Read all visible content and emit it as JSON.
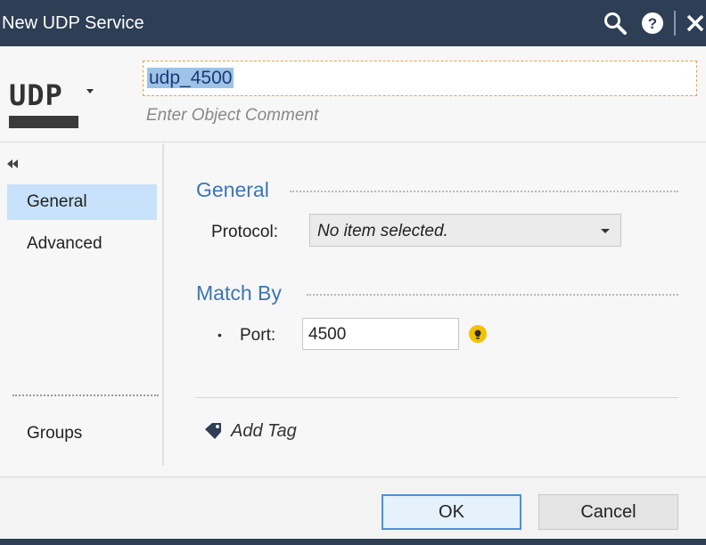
{
  "window": {
    "title": "New UDP Service"
  },
  "header": {
    "type_label": "UDP",
    "name_value": "udp_4500",
    "comment_placeholder": "Enter Object Comment"
  },
  "nav": {
    "items": [
      {
        "label": "General",
        "active": true
      },
      {
        "label": "Advanced",
        "active": false
      },
      {
        "label": "Groups",
        "active": false
      }
    ]
  },
  "general": {
    "title": "General",
    "protocol_label": "Protocol:",
    "protocol_value": "No item selected."
  },
  "match_by": {
    "title": "Match By",
    "port_label": "Port:",
    "port_value": "4500"
  },
  "tags": {
    "add_tag_label": "Add Tag"
  },
  "footer": {
    "ok_label": "OK",
    "cancel_label": "Cancel"
  },
  "icons": {
    "search": "search-icon",
    "help": "help-icon",
    "close": "close-icon",
    "collapse": "collapse-icon",
    "bulb": "lightbulb-icon",
    "tag": "tag-icon"
  },
  "colors": {
    "titlebar": "#2d3e55",
    "accent": "#3c76b4",
    "nav_active": "#c7e2fa",
    "bulb": "#f2c200"
  }
}
